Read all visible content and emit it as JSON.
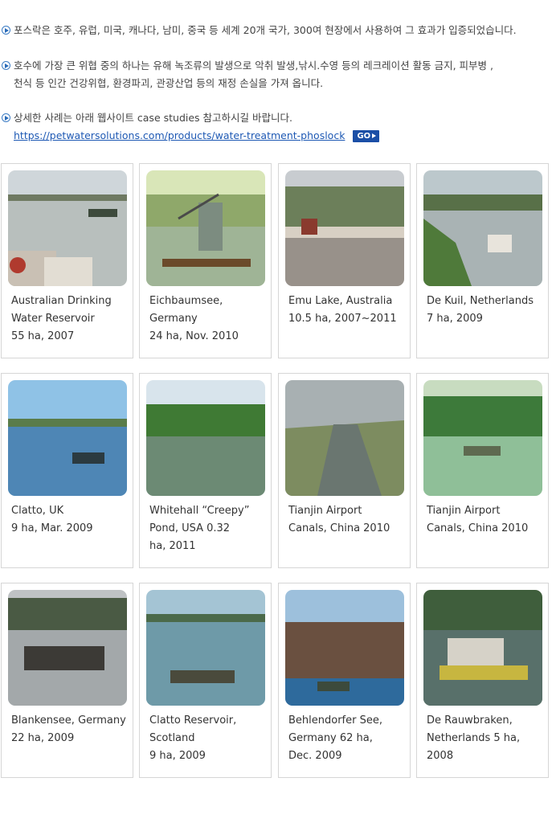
{
  "bullets": [
    {
      "lines": [
        "포스락은 호주, 유럽, 미국, 캐나다, 남미, 중국 등 세계 20개 국가, 300여 현장에서 사용하여 그 효과가 입증되었습니다."
      ]
    },
    {
      "lines": [
        "호수에 가장 큰 위협 중의 하나는 유해 녹조류의 발생으로 악취 발생,낚시.수영 등의 레크레이션 활동 금지, 피부병 ,",
        "천식 등 인간 건강위협, 환경파괴, 관광산업 등의 재정 손실을 가져 옵니다."
      ]
    },
    {
      "lines": [
        "상세한 사례는 아래 웹사이트  case studies  참고하시길  바랍니다."
      ],
      "link": "https://petwatersolutions.com/products/water-treatment-phoslock",
      "go_label": "GO"
    }
  ],
  "cases": [
    {
      "lines": [
        "Australian Drinking",
        "Water Reservoir",
        "55 ha, 2007"
      ]
    },
    {
      "lines": [
        "Eichbaumsee,",
        "Germany",
        "24 ha, Nov. 2010"
      ]
    },
    {
      "lines": [
        "Emu Lake, Australia",
        "10.5 ha, 2007~2011"
      ]
    },
    {
      "lines": [
        "De Kuil, Netherlands",
        "7 ha, 2009"
      ]
    },
    {
      "lines": [
        "Clatto, UK",
        "9 ha, Mar. 2009"
      ]
    },
    {
      "lines": [
        "Whitehall “Creepy”",
        "Pond, USA 0.32",
        "ha, 2011"
      ]
    },
    {
      "lines": [
        "Tianjin Airport",
        "Canals, China 2010"
      ]
    },
    {
      "lines": [
        "Tianjin Airport",
        "Canals, China 2010"
      ]
    },
    {
      "lines": [
        "Blankensee, Germany",
        "22 ha, 2009"
      ]
    },
    {
      "lines": [
        "Clatto Reservoir,",
        "Scotland",
        "9 ha, 2009"
      ]
    },
    {
      "lines": [
        "Behlendorfer See,",
        "Germany 62 ha,",
        "Dec. 2009"
      ]
    },
    {
      "lines": [
        "De Rauwbraken,",
        "Netherlands 5 ha, 2008"
      ]
    }
  ],
  "colors": {
    "accent": "#1b4fa6",
    "link": "#1e59b4",
    "border": "#d6d6d6"
  }
}
